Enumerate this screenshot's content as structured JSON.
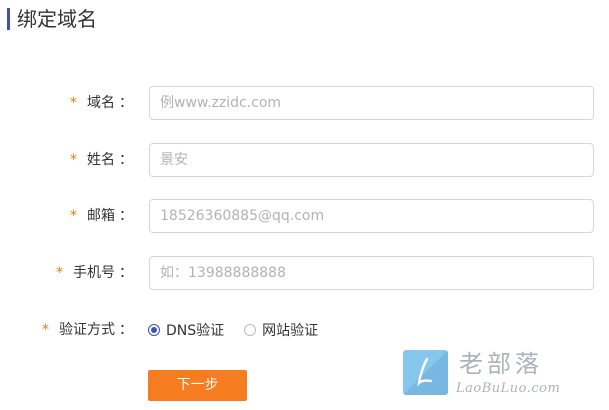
{
  "header": {
    "title": "绑定域名",
    "accent_color": "#3f51b5"
  },
  "form": {
    "required_marker": "*",
    "colon": "：",
    "fields": {
      "domain": {
        "label": "域名",
        "value": "",
        "placeholder": "例www.zzidc.com"
      },
      "name": {
        "label": "姓名",
        "value": "",
        "placeholder": "景安"
      },
      "email": {
        "label": "邮箱",
        "value": "",
        "placeholder": "18526360885@qq.com"
      },
      "phone": {
        "label": "手机号",
        "value": "",
        "placeholder": "如：13988888888"
      }
    },
    "verify_method": {
      "label": "验证方式",
      "options": [
        {
          "label": "DNS验证",
          "selected": true
        },
        {
          "label": "网站验证",
          "selected": false
        }
      ]
    },
    "next_button": {
      "label": "下一步",
      "color": "#f57c1f"
    }
  },
  "watermark": {
    "name_cn": "老部落",
    "name_en": "LaoBuLuo.com",
    "logo_icon": "l-logo-icon"
  }
}
